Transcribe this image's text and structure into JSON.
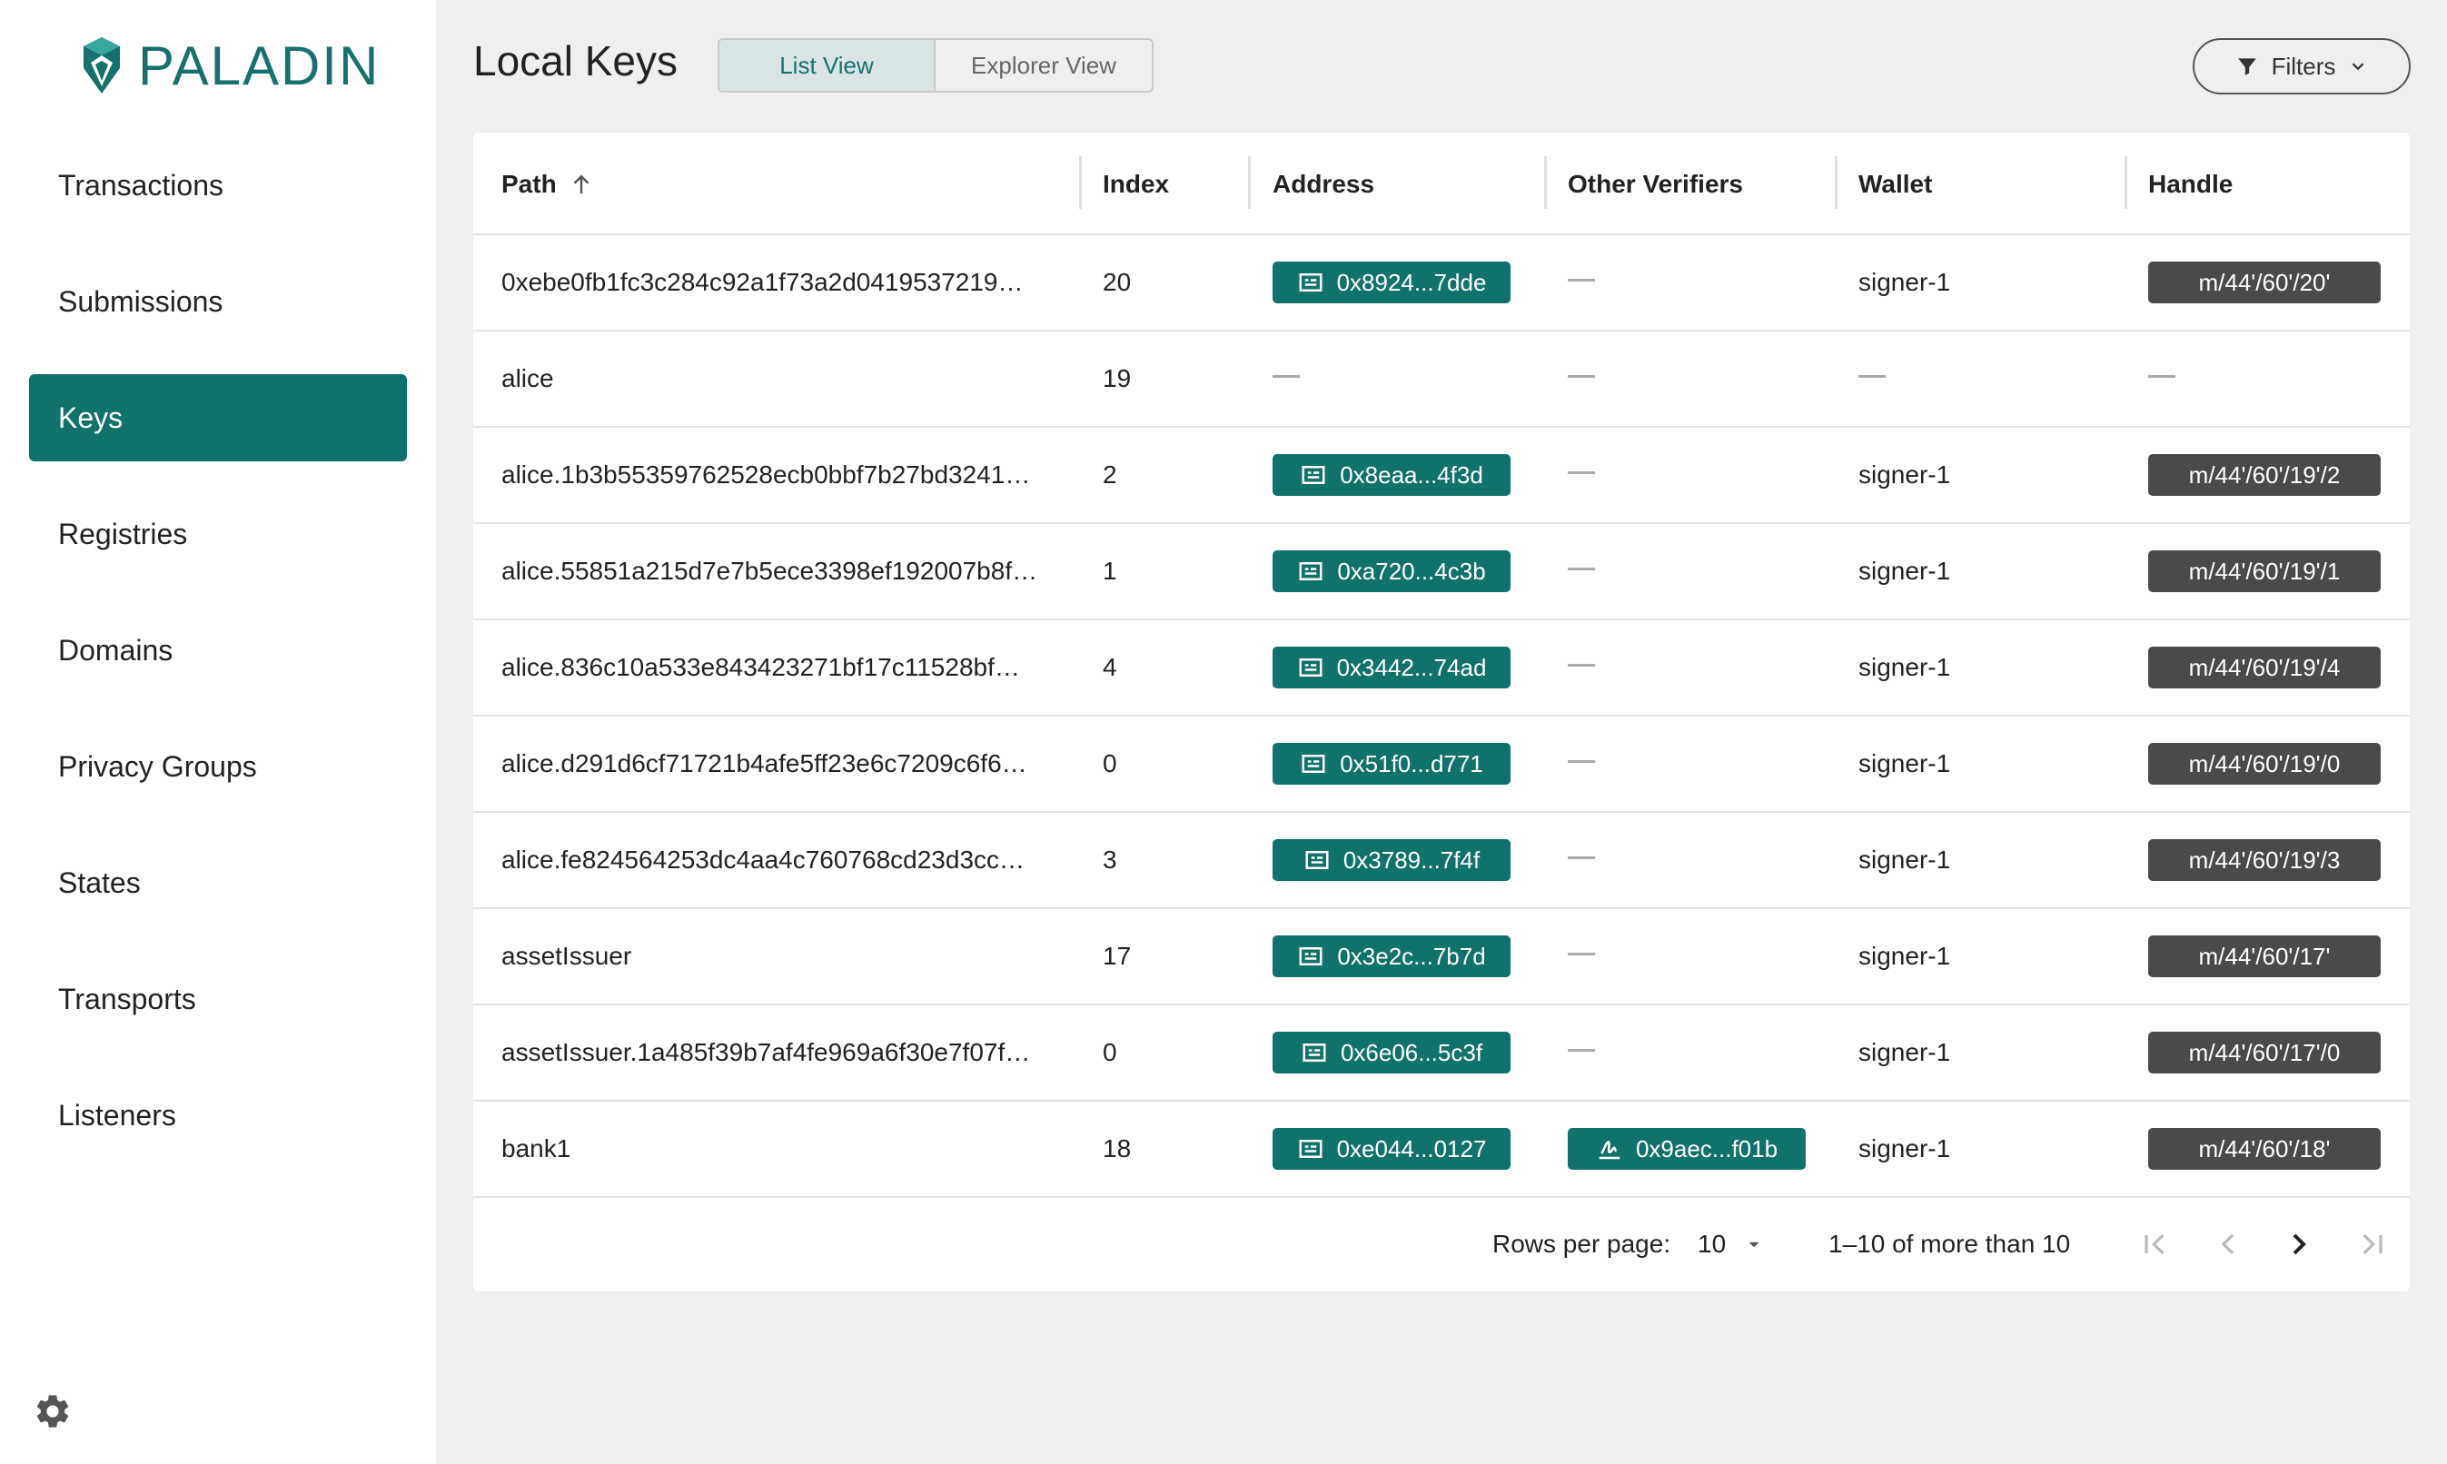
{
  "brand": {
    "name": "PALADIN"
  },
  "sidebar": {
    "items": [
      {
        "label": "Transactions",
        "active": false
      },
      {
        "label": "Submissions",
        "active": false
      },
      {
        "label": "Keys",
        "active": true
      },
      {
        "label": "Registries",
        "active": false
      },
      {
        "label": "Domains",
        "active": false
      },
      {
        "label": "Privacy Groups",
        "active": false
      },
      {
        "label": "States",
        "active": false
      },
      {
        "label": "Transports",
        "active": false
      },
      {
        "label": "Listeners",
        "active": false
      }
    ],
    "settings_icon": "gear-icon"
  },
  "header": {
    "title": "Local Keys",
    "views": [
      {
        "label": "List View",
        "active": true
      },
      {
        "label": "Explorer View",
        "active": false
      }
    ],
    "filters_label": "Filters"
  },
  "table": {
    "columns": [
      "Path",
      "Index",
      "Address",
      "Other Verifiers",
      "Wallet",
      "Handle"
    ],
    "sort": {
      "column": "Path",
      "direction": "asc"
    },
    "rows": [
      {
        "path": "0xebe0fb1fc3c284c92a1f73a2d0419537219…",
        "index": "20",
        "address": "0x8924...7dde",
        "other_verifier": "",
        "wallet": "signer-1",
        "handle": "m/44'/60'/20'"
      },
      {
        "path": "alice",
        "index": "19",
        "address": "",
        "other_verifier": "",
        "wallet": "",
        "handle": ""
      },
      {
        "path": "alice.1b3b55359762528ecb0bbf7b27bd3241…",
        "index": "2",
        "address": "0x8eaa...4f3d",
        "other_verifier": "",
        "wallet": "signer-1",
        "handle": "m/44'/60'/19'/2"
      },
      {
        "path": "alice.55851a215d7e7b5ece3398ef192007b8f…",
        "index": "1",
        "address": "0xa720...4c3b",
        "other_verifier": "",
        "wallet": "signer-1",
        "handle": "m/44'/60'/19'/1"
      },
      {
        "path": "alice.836c10a533e843423271bf17c11528bf…",
        "index": "4",
        "address": "0x3442...74ad",
        "other_verifier": "",
        "wallet": "signer-1",
        "handle": "m/44'/60'/19'/4"
      },
      {
        "path": "alice.d291d6cf71721b4afe5ff23e6c7209c6f6…",
        "index": "0",
        "address": "0x51f0...d771",
        "other_verifier": "",
        "wallet": "signer-1",
        "handle": "m/44'/60'/19'/0"
      },
      {
        "path": "alice.fe824564253dc4aa4c760768cd23d3cc…",
        "index": "3",
        "address": "0x3789...7f4f",
        "other_verifier": "",
        "wallet": "signer-1",
        "handle": "m/44'/60'/19'/3"
      },
      {
        "path": "assetIssuer",
        "index": "17",
        "address": "0x3e2c...7b7d",
        "other_verifier": "",
        "wallet": "signer-1",
        "handle": "m/44'/60'/17'"
      },
      {
        "path": "assetIssuer.1a485f39b7af4fe969a6f30e7f07f…",
        "index": "0",
        "address": "0x6e06...5c3f",
        "other_verifier": "",
        "wallet": "signer-1",
        "handle": "m/44'/60'/17'/0"
      },
      {
        "path": "bank1",
        "index": "18",
        "address": "0xe044...0127",
        "other_verifier": "0x9aec...f01b",
        "wallet": "signer-1",
        "handle": "m/44'/60'/18'"
      }
    ]
  },
  "pagination": {
    "rows_per_page_label": "Rows per page:",
    "rows_per_page": "10",
    "range_text": "1–10 of more than 10"
  },
  "colors": {
    "brand": "#16706c",
    "active_nav": "#11716c",
    "handle_chip": "#4a4a4a",
    "background": "#efefef"
  }
}
